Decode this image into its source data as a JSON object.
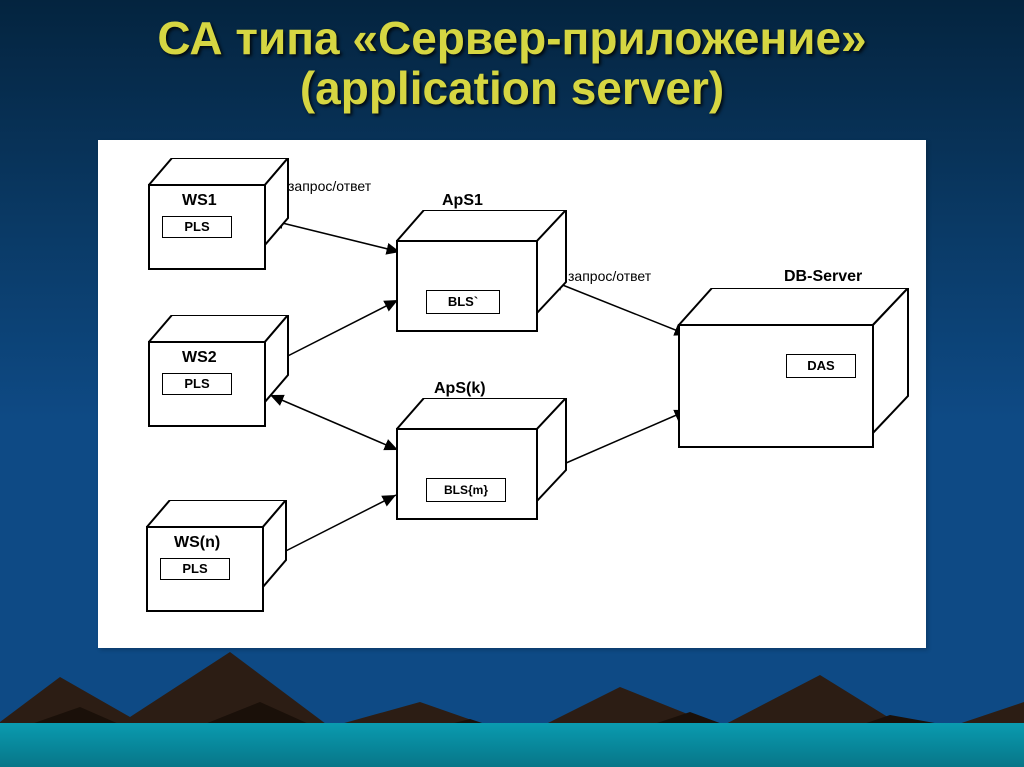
{
  "title_line1": "СА типа «Сервер-приложение»",
  "title_line2": "(application server)",
  "nodes": {
    "ws1": {
      "label": "WS1",
      "box": "PLS"
    },
    "ws2": {
      "label": "WS2",
      "box": "PLS"
    },
    "wsn": {
      "label": "WS(n)",
      "box": "PLS"
    },
    "aps1": {
      "label": "ApS1",
      "box": "BLS`"
    },
    "apsk": {
      "label": "ApS(k)",
      "box": "BLS{m}"
    },
    "db": {
      "label": "DB-Server",
      "box": "DAS"
    }
  },
  "annotations": {
    "req_resp1": "запрос/ответ",
    "req_resp2": "запрос/ответ"
  }
}
